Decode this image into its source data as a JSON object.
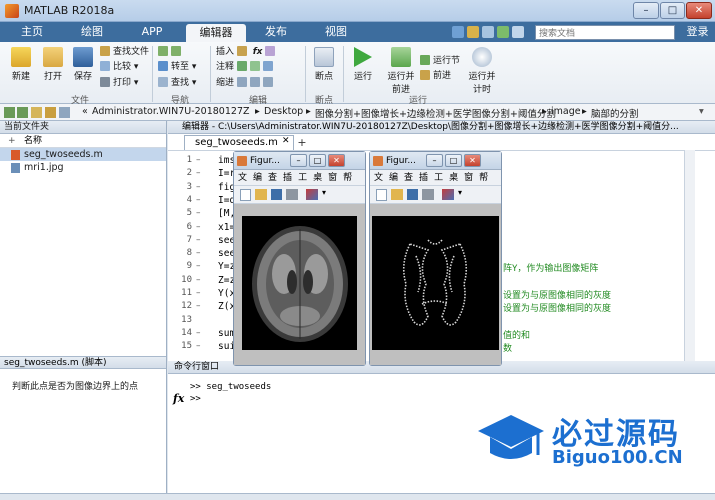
{
  "window": {
    "title": "MATLAB R2018a",
    "min": "–",
    "max": "□",
    "close": "✕"
  },
  "tabs": [
    "主页",
    "绘图",
    "APP",
    "编辑器",
    "发布",
    "视图"
  ],
  "search": {
    "placeholder": "搜索文档"
  },
  "login": "登录",
  "ribbon": {
    "file": {
      "new": "新建",
      "open": "打开",
      "save": "保存",
      "find_files": "查找文件",
      "compare": "比较",
      "print": "打印",
      "label": "文件"
    },
    "nav": {
      "goto": "转至",
      "find": "查找",
      "label": "导航"
    },
    "edit": {
      "insert": "插入",
      "comment": "注释",
      "indent": "缩进",
      "label": "编辑"
    },
    "breakpoints": {
      "bp": "断点",
      "label": "断点"
    },
    "run": {
      "run": "运行",
      "run_advance": "运行并\n前进",
      "run_section": "运行节",
      "advance": "前进",
      "run_time": "运行并\n计时",
      "label": "运行"
    }
  },
  "path": [
    "«",
    "Administrator.WIN7U-20180127Z",
    "Desktop",
    "图像分割+图像增长+边缘检测+医学图像分割+阈值分割",
    "image",
    "脑部的分割"
  ],
  "left_panel": {
    "title": "当前文件夹",
    "column": "名称",
    "files": [
      "seg_twoseeds.m",
      "mri1.jpg"
    ],
    "details_title": "seg_twoseeds.m  (脚本)",
    "details_text": "判断此点是否为图像边界上的点"
  },
  "editor": {
    "title": "编辑器 - C:\\Users\\Administrator.WIN7U-20180127Z\\Desktop\\图像分割+图像增长+边缘检测+医学图像分割+阈值分...",
    "tab": "seg_twoseeds.m",
    "lines": [
      {
        "n": "1",
        "code": "ims"
      },
      {
        "n": "2",
        "code": "I=r"
      },
      {
        "n": "3",
        "code": "fig"
      },
      {
        "n": "4",
        "code": "I=d"
      },
      {
        "n": "5",
        "code": "[M,"
      },
      {
        "n": "6",
        "code": "x1="
      },
      {
        "n": "7",
        "code": "see"
      },
      {
        "n": "8",
        "code": "see"
      },
      {
        "n": "9",
        "code": "Y=z"
      },
      {
        "n": "10",
        "code": "Z=z"
      },
      {
        "n": "11",
        "code": "Y(x"
      },
      {
        "n": "12",
        "code": "Z(x"
      },
      {
        "n": "13",
        "code": ""
      },
      {
        "n": "14",
        "code": "sum"
      },
      {
        "n": "15",
        "code": "sui"
      }
    ],
    "comments": [
      {
        "line": "9",
        "text": "阵Y，作为输出图像矩阵"
      },
      {
        "line": "11",
        "text": "设置为与原图像相同的灰度"
      },
      {
        "line": "12",
        "text": "设置为与原图像相同的灰度"
      },
      {
        "line": "14",
        "text": "值的和"
      },
      {
        "line": "15",
        "text": "数"
      }
    ]
  },
  "command": {
    "title": "命令行窗口",
    "lines": [
      ">> seg_twoseeds",
      ">>"
    ],
    "fx": "fx"
  },
  "figures": [
    {
      "title": "Figur...",
      "menu": [
        "文",
        "编",
        "查",
        "插",
        "工",
        "桌",
        "窗",
        "帮"
      ]
    },
    {
      "title": "Figur...",
      "menu": [
        "文",
        "编",
        "查",
        "插",
        "工",
        "桌",
        "窗",
        "帮"
      ]
    }
  ],
  "watermark": {
    "line1": "必过源码",
    "line2": "Biguo100.CN"
  }
}
